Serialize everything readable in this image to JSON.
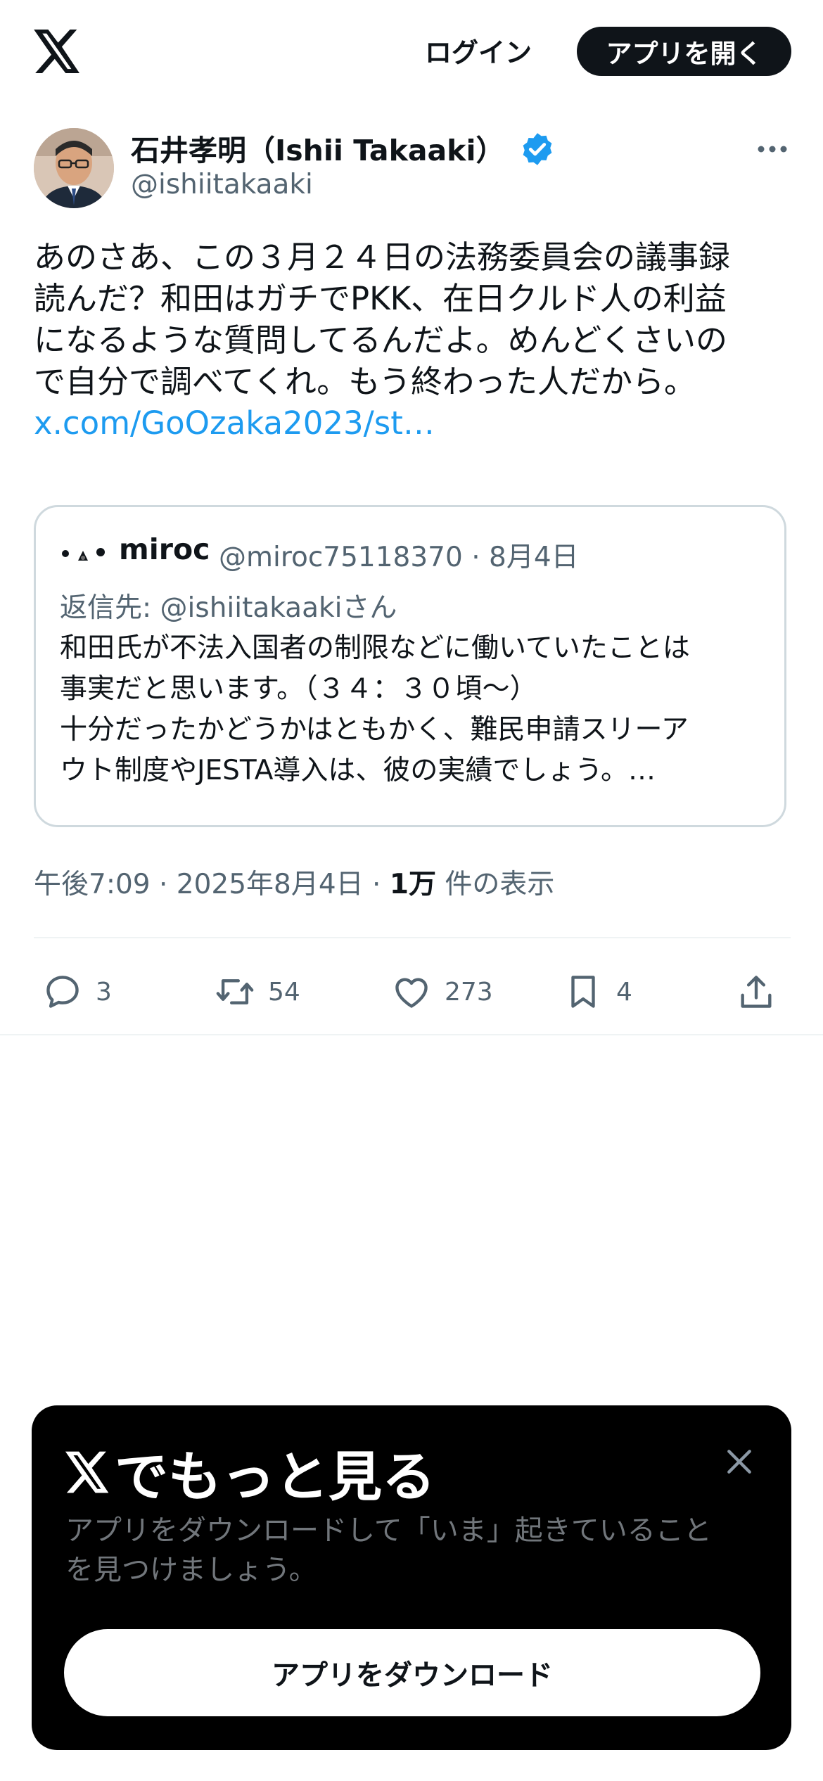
{
  "header": {
    "logo_icon": "x-logo-icon",
    "login_label": "ログイン",
    "open_app_label": "アプリを開く"
  },
  "tweet": {
    "author_name": "石井孝明（Ishii Takaaki）",
    "handle": "@ishiitakaaki",
    "verified": true,
    "verified_color": "#1d9bf0",
    "text_lines": [
      "あのさあ、この３月２４日の法務委員会の議事録",
      "読んだ？和田はガチでPKK、在日クルド人の利益",
      "になるような質問してるんだよ。めんどくさいの",
      "で自分で調べてくれ。もう終わった人だから。"
    ],
    "link": "x.com/GoOzaka2023/st…",
    "quote": {
      "name": "miroc",
      "handle_date": "@miroc75118370 · 8月4日",
      "reply_prefix": "返信先: ",
      "reply_mention": "@ishiitakaakiさん",
      "text_lines": [
        "和田氏が不法入国者の制限などに働いていたことは",
        "事実だと思います。（３４：３０頃〜）",
        "十分だったかどうかはともかく、難民申請スリーア",
        "ウト制度やJESTA導入は、彼の実績でしょう。…"
      ]
    },
    "meta_time": "午後7:09 · 2025年8月4日 · ",
    "meta_views_count": "1万",
    "meta_views_label": " 件の表示",
    "actions": {
      "reply_count": "3",
      "retweet_count": "54",
      "like_count": "273",
      "bookmark_count": "4"
    }
  },
  "promo": {
    "title": "でもっと見る",
    "desc_lines": [
      "アプリをダウンロードして「いま」起きていること",
      "を見つけましょう。"
    ],
    "button_label": "アプリをダウンロード"
  }
}
